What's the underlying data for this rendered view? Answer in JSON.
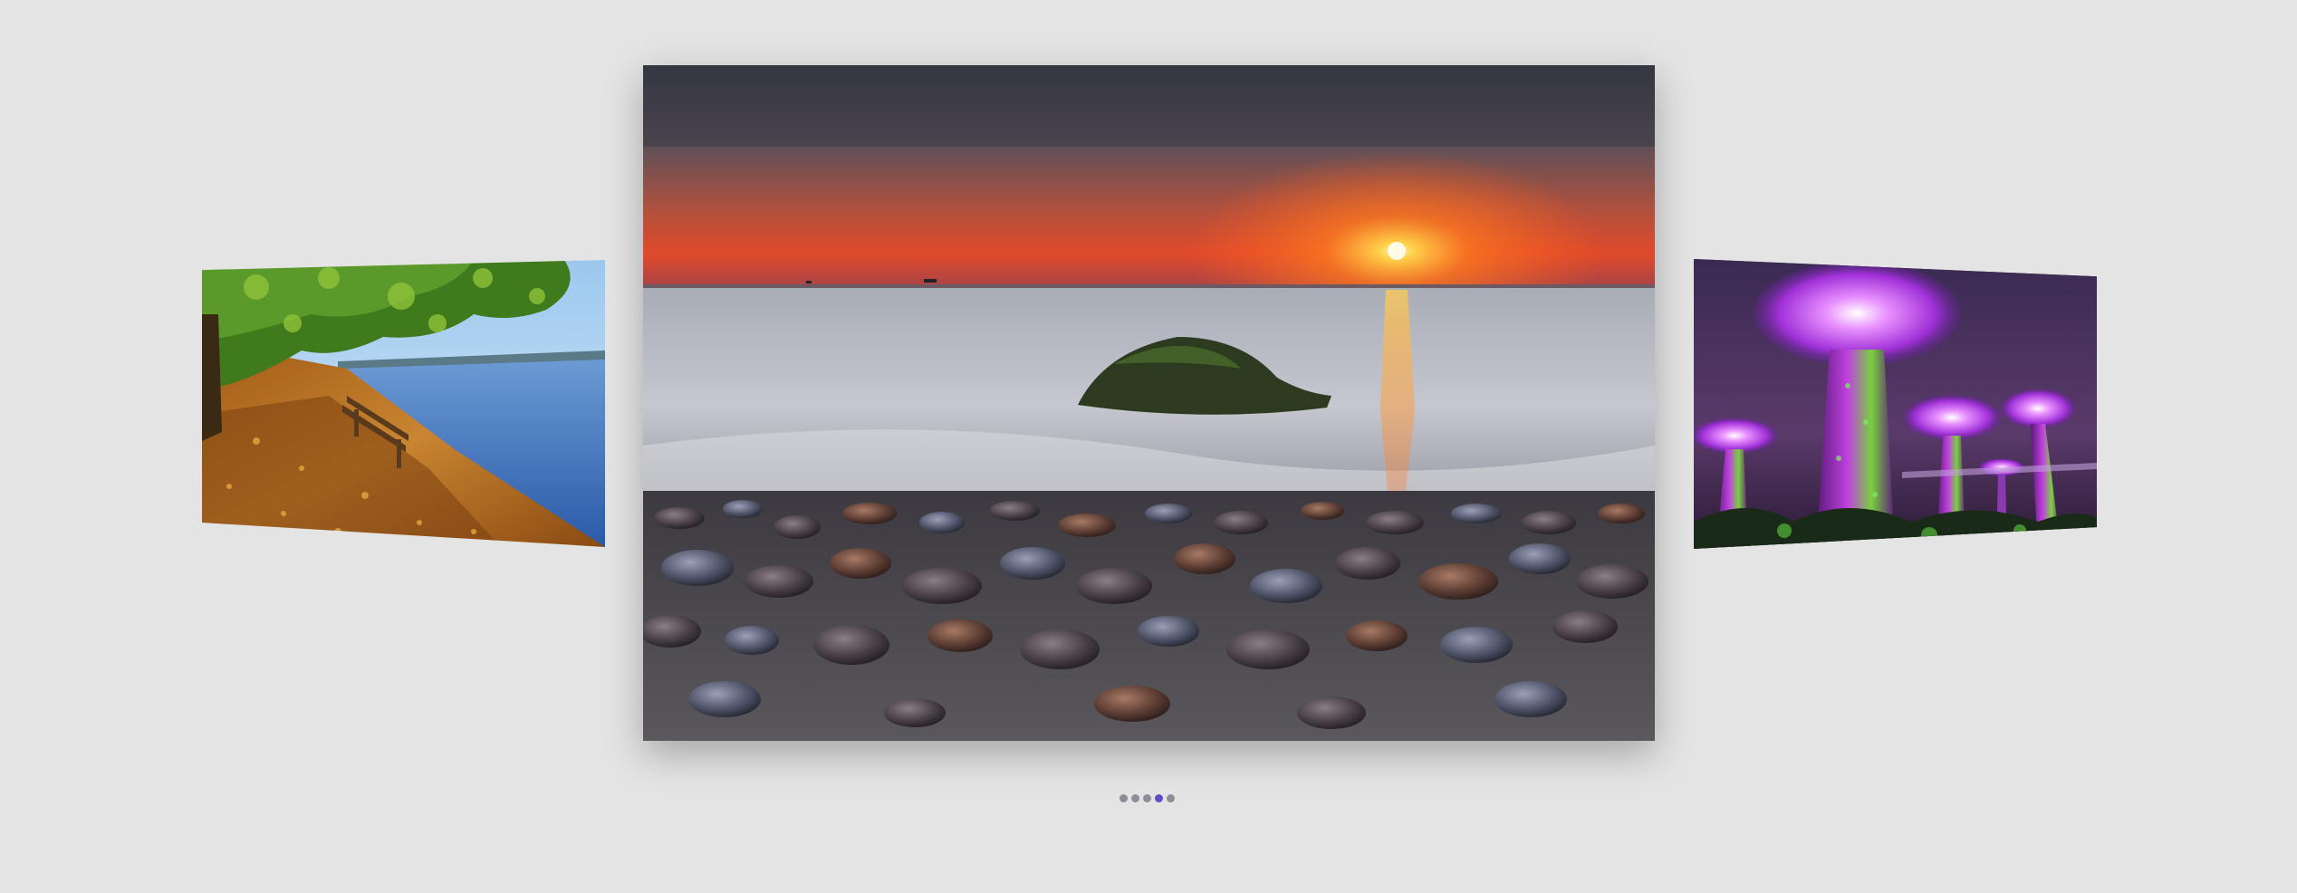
{
  "carousel": {
    "slides": [
      {
        "icon": "lakeside-bench-image",
        "position": "previous"
      },
      {
        "icon": "sunset-pebble-beach-image",
        "position": "current"
      },
      {
        "icon": "supertree-grove-night-image",
        "position": "next"
      }
    ],
    "pagination": {
      "count": 5,
      "active_index": 3
    }
  },
  "colors": {
    "background": "#e4e4e4",
    "dot_inactive": "#8d8d98",
    "dot_active": "#5a4fc8"
  }
}
